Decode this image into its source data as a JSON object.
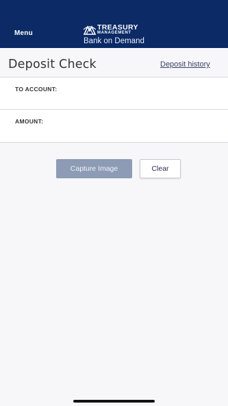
{
  "header": {
    "menu_label": "Menu",
    "logo_line1": "TREASURY",
    "logo_line2": "MANAGEMENT",
    "logo_subtitle": "Bank on Demand",
    "background_color": "#0b2a66"
  },
  "page": {
    "title": "Deposit Check",
    "history_link": "Deposit history"
  },
  "form": {
    "to_account_label": "TO ACCOUNT:",
    "to_account_value": "",
    "amount_label": "AMOUNT:",
    "amount_value": ""
  },
  "actions": {
    "capture_label": "Capture Image",
    "clear_label": "Clear",
    "capture_color": "#8e9bb5"
  },
  "icons": {
    "logo_mark": "treasury-logo-icon"
  }
}
